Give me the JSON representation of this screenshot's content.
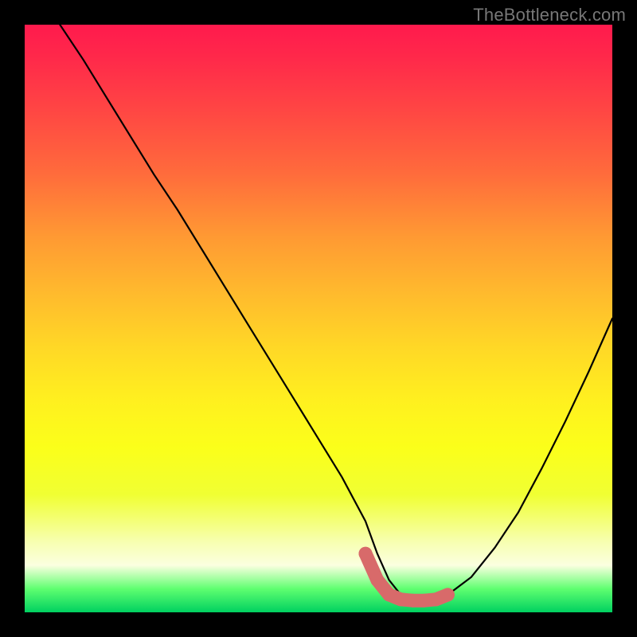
{
  "watermark": "TheBottleneck.com",
  "chart_data": {
    "type": "line",
    "title": "",
    "xlabel": "",
    "ylabel": "",
    "xlim": [
      0,
      100
    ],
    "ylim": [
      0,
      100
    ],
    "series": [
      {
        "name": "bottleneck-curve",
        "x": [
          6,
          10,
          14,
          18,
          22,
          26,
          30,
          34,
          38,
          42,
          46,
          50,
          54,
          58,
          60,
          62,
          64,
          66,
          68,
          70,
          72,
          76,
          80,
          84,
          88,
          92,
          96,
          100
        ],
        "values": [
          100,
          94,
          87.5,
          81,
          74.5,
          68.5,
          62,
          55.5,
          49,
          42.5,
          36,
          29.5,
          23,
          15.5,
          10,
          5.5,
          3,
          2,
          2,
          2,
          3,
          6,
          11,
          17,
          24.5,
          32.5,
          41,
          50
        ]
      }
    ],
    "markers": {
      "name": "highlight-band",
      "color": "#d86a6a",
      "x": [
        58,
        60,
        62,
        64,
        66,
        68,
        70,
        72
      ],
      "values": [
        10,
        5.5,
        3,
        2.2,
        2,
        2,
        2.2,
        3
      ]
    },
    "gradient_stops": [
      {
        "pos": 0,
        "color": "#ff1a4d"
      },
      {
        "pos": 25,
        "color": "#ff6a3c"
      },
      {
        "pos": 55,
        "color": "#ffd826"
      },
      {
        "pos": 80,
        "color": "#f0ff33"
      },
      {
        "pos": 96,
        "color": "#5fff70"
      },
      {
        "pos": 100,
        "color": "#00d060"
      }
    ]
  }
}
